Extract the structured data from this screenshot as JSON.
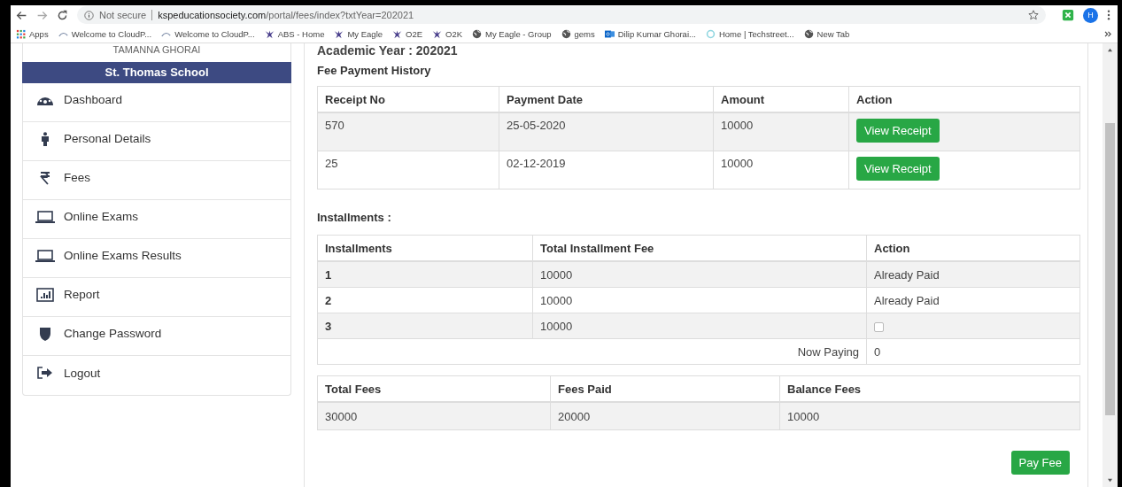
{
  "browser": {
    "security": "Not secure",
    "url_host": "kspeducationsociety.com",
    "url_path": "/portal/fees/index?txtYear=202021",
    "profile_initial": "H",
    "bookmarks": [
      {
        "kind": "apps",
        "label": "Apps"
      },
      {
        "kind": "cloud",
        "label": "Welcome to CloudP..."
      },
      {
        "kind": "cloud",
        "label": "Welcome to CloudP..."
      },
      {
        "kind": "eagle",
        "label": "ABS - Home"
      },
      {
        "kind": "eagle",
        "label": "My Eagle"
      },
      {
        "kind": "eagle",
        "label": "O2E"
      },
      {
        "kind": "eagle",
        "label": "O2K"
      },
      {
        "kind": "globe",
        "label": "My Eagle - Group"
      },
      {
        "kind": "globe",
        "label": "gems"
      },
      {
        "kind": "outlook",
        "label": "Dilip Kumar Ghorai..."
      },
      {
        "kind": "swirl",
        "label": "Home | Techstreet..."
      },
      {
        "kind": "globe",
        "label": "New Tab"
      }
    ]
  },
  "sidebar": {
    "student_name": "TAMANNA GHORAI",
    "school": "St. Thomas School",
    "items": [
      {
        "kind": "dashboard",
        "label": "Dashboard"
      },
      {
        "kind": "person",
        "label": "Personal Details"
      },
      {
        "kind": "rupee",
        "label": "Fees"
      },
      {
        "kind": "laptop",
        "label": "Online Exams"
      },
      {
        "kind": "laptop",
        "label": "Online Exams Results"
      },
      {
        "kind": "chart",
        "label": "Report"
      },
      {
        "kind": "shield",
        "label": "Change Password"
      },
      {
        "kind": "logout",
        "label": "Logout"
      }
    ]
  },
  "main": {
    "academic_year": "Academic Year : 202021",
    "history": {
      "title": "Fee Payment History",
      "columns": [
        "Receipt No",
        "Payment Date",
        "Amount",
        "Action"
      ],
      "rows": [
        {
          "receipt_no": "570",
          "payment_date": "25-05-2020",
          "amount": "10000",
          "action": "View Receipt"
        },
        {
          "receipt_no": "25",
          "payment_date": "02-12-2019",
          "amount": "10000",
          "action": "View Receipt"
        }
      ]
    },
    "installments": {
      "title": "Installments :",
      "columns": [
        "Installments",
        "Total Installment Fee",
        "Action"
      ],
      "rows": [
        {
          "number": "1",
          "fee": "10000",
          "kind": "paid",
          "status": "Already Paid"
        },
        {
          "number": "2",
          "fee": "10000",
          "kind": "paid",
          "status": "Already Paid"
        },
        {
          "number": "3",
          "fee": "10000",
          "kind": "checkbox",
          "checked": false
        }
      ],
      "now_paying": {
        "label": "Now Paying",
        "value": "0"
      }
    },
    "totals": {
      "columns": [
        "Total Fees",
        "Fees Paid",
        "Balance Fees"
      ],
      "values": [
        "30000",
        "20000",
        "10000"
      ]
    },
    "pay_button": "Pay Fee"
  }
}
